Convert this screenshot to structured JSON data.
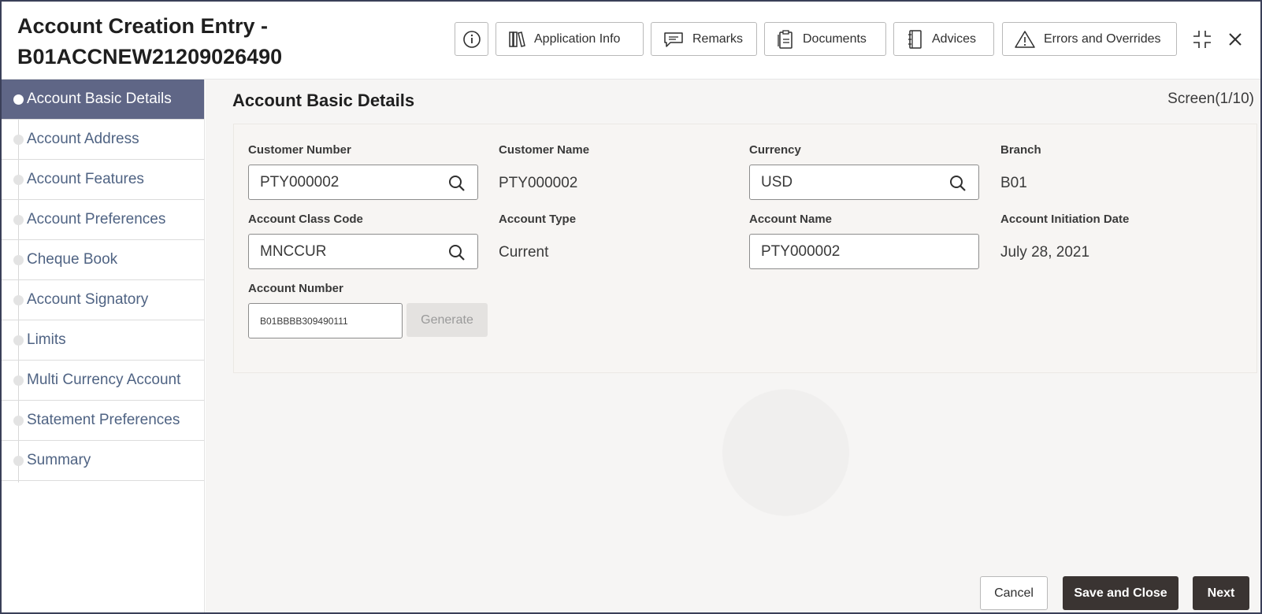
{
  "header": {
    "title_line1": "Account Creation Entry -",
    "title_line2": "B01ACCNEW21209026490",
    "buttons": {
      "application_info": "Application Info",
      "remarks": "Remarks",
      "documents": "Documents",
      "advices": "Advices",
      "errors_overrides": "Errors and Overrides"
    }
  },
  "sidebar": {
    "items": [
      {
        "label": "Account Basic Details",
        "active": true
      },
      {
        "label": "Account Address"
      },
      {
        "label": "Account Features"
      },
      {
        "label": "Account Preferences"
      },
      {
        "label": "Cheque Book"
      },
      {
        "label": "Account Signatory"
      },
      {
        "label": "Limits"
      },
      {
        "label": "Multi Currency Account"
      },
      {
        "label": "Statement Preferences"
      },
      {
        "label": "Summary"
      }
    ]
  },
  "main": {
    "section_title": "Account Basic Details",
    "screen_count": "Screen(1/10)",
    "fields": {
      "customer_number": {
        "label": "Customer Number",
        "value": "PTY000002"
      },
      "customer_name": {
        "label": "Customer Name",
        "value": "PTY000002"
      },
      "currency": {
        "label": "Currency",
        "value": "USD"
      },
      "branch": {
        "label": "Branch",
        "value": "B01"
      },
      "account_class_code": {
        "label": "Account Class Code",
        "value": "MNCCUR"
      },
      "account_type": {
        "label": "Account Type",
        "value": "Current"
      },
      "account_name": {
        "label": "Account Name",
        "value": "PTY000002"
      },
      "account_initiation_date": {
        "label": "Account Initiation Date",
        "value": "July 28, 2021"
      },
      "account_number": {
        "label": "Account Number",
        "value": "B01BBBB309490111"
      }
    },
    "generate_label": "Generate"
  },
  "footer": {
    "cancel": "Cancel",
    "save_close": "Save and Close",
    "next": "Next"
  },
  "colors": {
    "sidebar_active": "#5f6686",
    "primary_button": "#3a3432",
    "nav_text": "#4f6383"
  }
}
